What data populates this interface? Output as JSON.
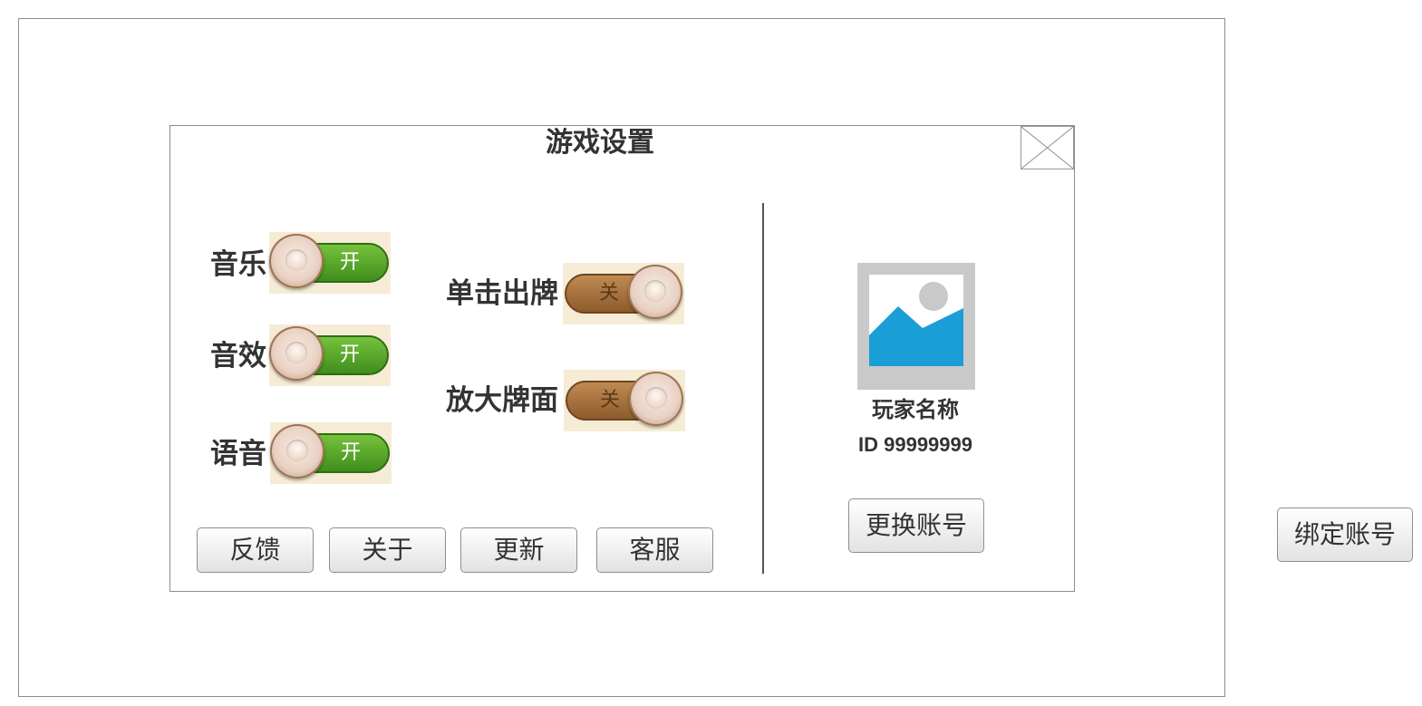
{
  "dialog": {
    "title": "游戏设置"
  },
  "settings": {
    "left": [
      {
        "label": "音乐",
        "state": "开"
      },
      {
        "label": "音效",
        "state": "开"
      },
      {
        "label": "语音",
        "state": "开"
      }
    ],
    "right": [
      {
        "label": "单击出牌",
        "state": "关"
      },
      {
        "label": "放大牌面",
        "state": "关"
      }
    ]
  },
  "buttons": {
    "feedback": "反馈",
    "about": "关于",
    "update": "更新",
    "support": "客服"
  },
  "player": {
    "name": "玩家名称",
    "id": "ID 99999999",
    "switch_account": "更换账号"
  },
  "bind_account": "绑定账号",
  "colors": {
    "toggle_on": "#4fa32a",
    "toggle_off": "#a87040",
    "avatar_placeholder_sky": "#ffffff",
    "avatar_placeholder_mountain": "#1a9ed8"
  },
  "icons": {
    "close": "close-placeholder-icon",
    "avatar": "image-placeholder-icon"
  }
}
